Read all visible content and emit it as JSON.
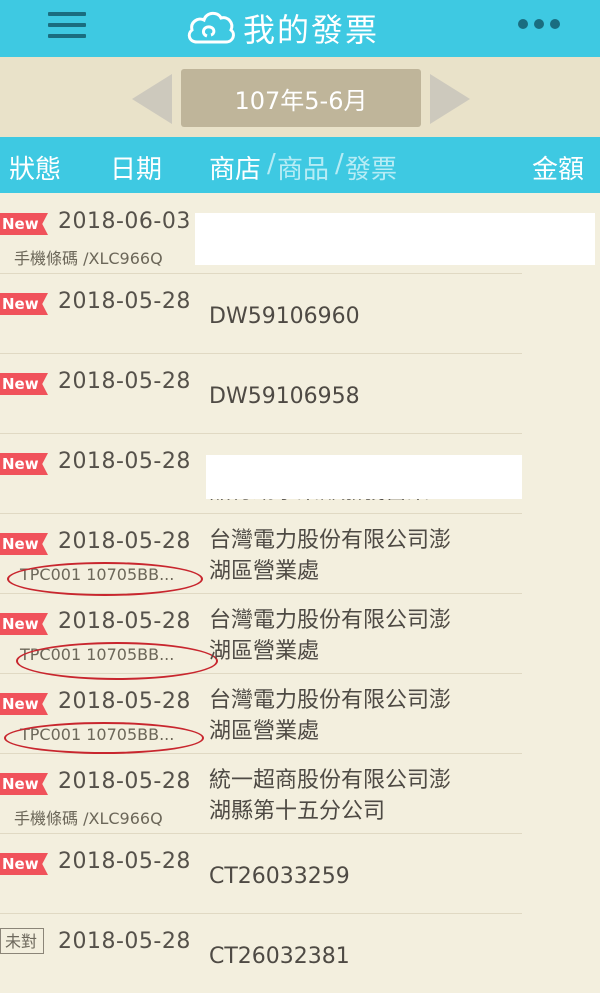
{
  "header": {
    "title": "我的發票"
  },
  "period": {
    "label": "107年5-6月"
  },
  "columns": {
    "status": "狀態",
    "date": "日期",
    "store": "商店",
    "sep1": "/",
    "goods": "商品",
    "sep2": "/",
    "invoice": "發票",
    "amount": "金額"
  },
  "rows": [
    {
      "tag": "New",
      "date": "2018-06-03",
      "sub": "手機條碼 /XLC966Q",
      "store_lines": [],
      "redacted": true
    },
    {
      "tag": "New",
      "date": "2018-05-28",
      "sub": "",
      "store_lines": [
        "DW59106960"
      ]
    },
    {
      "tag": "New",
      "date": "2018-05-28",
      "sub": "",
      "store_lines": [
        "DW59106958"
      ]
    },
    {
      "tag": "New",
      "date": "2018-05-28",
      "sub": "",
      "store_lines": [
        "",
        "品行銷事業部嘉義營業..."
      ],
      "redacted": true
    },
    {
      "tag": "New",
      "date": "2018-05-28",
      "sub": "TPC001 10705BB...",
      "store_lines": [
        "台灣電力股份有限公司澎",
        "湖區營業處"
      ]
    },
    {
      "tag": "New",
      "date": "2018-05-28",
      "sub": "TPC001 10705BB...",
      "store_lines": [
        "台灣電力股份有限公司澎",
        "湖區營業處"
      ]
    },
    {
      "tag": "New",
      "date": "2018-05-28",
      "sub": "TPC001 10705BB...",
      "store_lines": [
        "台灣電力股份有限公司澎",
        "湖區營業處"
      ]
    },
    {
      "tag": "New",
      "date": "2018-05-28",
      "sub": "手機條碼 /XLC966Q",
      "store_lines": [
        "統一超商股份有限公司澎",
        "湖縣第十五分公司"
      ]
    },
    {
      "tag": "New",
      "date": "2018-05-28",
      "sub": "",
      "store_lines": [
        "CT26033259"
      ]
    },
    {
      "tag": "未對",
      "date": "2018-05-28",
      "sub": "",
      "store_lines": [
        "CT26032381"
      ]
    }
  ],
  "colors": {
    "header": "#3ec9e2",
    "new_tag": "#f0525b",
    "oval": "#c8262e"
  }
}
